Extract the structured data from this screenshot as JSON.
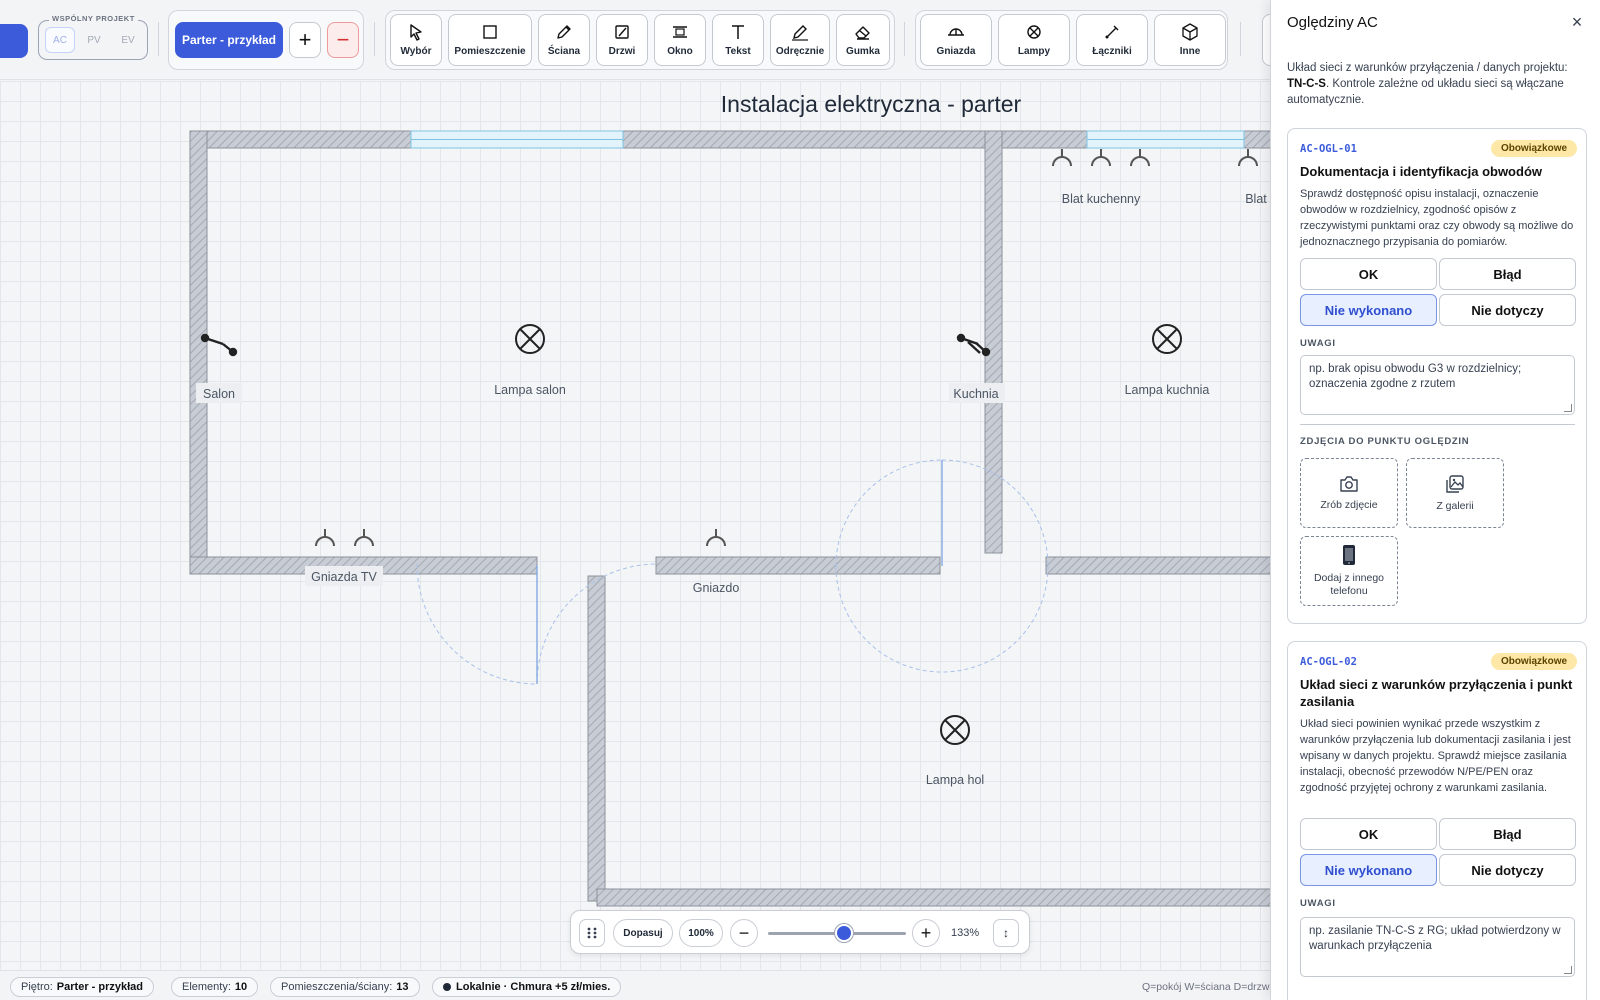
{
  "toolbar": {
    "shared_project": {
      "title": "WSPÓLNY PROJEKT",
      "tabs": [
        "AC",
        "PV",
        "EV"
      ],
      "active": "AC"
    },
    "floor": {
      "label": "Parter - przykład",
      "add": "+",
      "remove": "−"
    },
    "drawing_tools": [
      "Wybór",
      "Pomieszczenie",
      "Ściana",
      "Drzwi",
      "Okno",
      "Tekst",
      "Odręcznie",
      "Gumka"
    ],
    "element_tools": [
      "Gniazda",
      "Lampy",
      "Łączniki",
      "Inne"
    ]
  },
  "canvas": {
    "title": "Instalacja elektryczna - parter",
    "labels": {
      "blat_kuchenny": "Blat kuchenny",
      "blat_cut": "Blat",
      "salon": "Salon",
      "lampa_salon": "Lampa salon",
      "kuchnia": "Kuchnia",
      "lampa_kuchnia": "Lampa kuchnia",
      "gniazda_tv": "Gniazda TV",
      "gniazdo": "Gniazdo",
      "lampa_hol": "Lampa hol"
    }
  },
  "zoom": {
    "fit_label": "Dopasuj",
    "reset_label": "100%",
    "minus": "−",
    "plus": "+",
    "value": "133%",
    "toggle": "↕",
    "slider_fraction": 0.55
  },
  "status": {
    "floor_label": "Piętro:",
    "floor_value": "Parter - przykład",
    "elements_label": "Elementy:",
    "elements_value": "10",
    "rooms_label": "Pomieszczenia/ściany:",
    "rooms_value": "13",
    "sync": "Lokalnie · Chmura +5 zł/mies.",
    "shortcuts": "Q=pokój W=ściana D=drzw"
  },
  "panel": {
    "title": "Oględziny AC",
    "close": "×",
    "intro_text": "Układ sieci z warunków przyłączenia / danych projektu:",
    "intro_value": "TN-C-S",
    "intro_rest": ". Kontrole zależne od układu sieci są włączane automatycznie.",
    "result_options": [
      "OK",
      "Błąd",
      "Nie wykonano",
      "Nie dotyczy"
    ],
    "notes_label": "UWAGI",
    "photos_label": "ZDJĘCIA DO PUNKTU OGLĘDZIN",
    "photo_buttons": [
      "Zrób zdjęcie",
      "Z galerii",
      "Dodaj z innego telefonu"
    ],
    "cards": [
      {
        "code": "AC-OGL-01",
        "badge": "Obowiązkowe",
        "heading": "Dokumentacja i identyfikacja obwodów",
        "description": "Sprawdź dostępność opisu instalacji, oznaczenie obwodów w rozdzielnicy, zgodność opisów z rzeczywistymi punktami oraz czy obwody są możliwe do jednoznacznego przypisania do pomiarów.",
        "selected": "Nie wykonano",
        "notes_placeholder": "np. brak opisu obwodu G3 w rozdzielnicy; oznaczenia zgodne z rzutem"
      },
      {
        "code": "AC-OGL-02",
        "badge": "Obowiązkowe",
        "heading": "Układ sieci z warunków przyłączenia i punkt zasilania",
        "description": "Układ sieci powinien wynikać przede wszystkim z warunków przyłączenia lub dokumentacji zasilania i jest wpisany w danych projektu. Sprawdź miejsce zasilania instalacji, obecność przewodów N/PE/PEN oraz zgodność przyjętej ochrony z warunkami zasilania.",
        "selected": "Nie wykonano",
        "notes_placeholder": "np. zasilanie TN-C-S z RG; układ potwierdzony w warunkach przyłączenia"
      }
    ]
  },
  "colors": {
    "accent": "#3b5bdb",
    "badge": "#fde8a8",
    "danger": "#d32f2f"
  }
}
